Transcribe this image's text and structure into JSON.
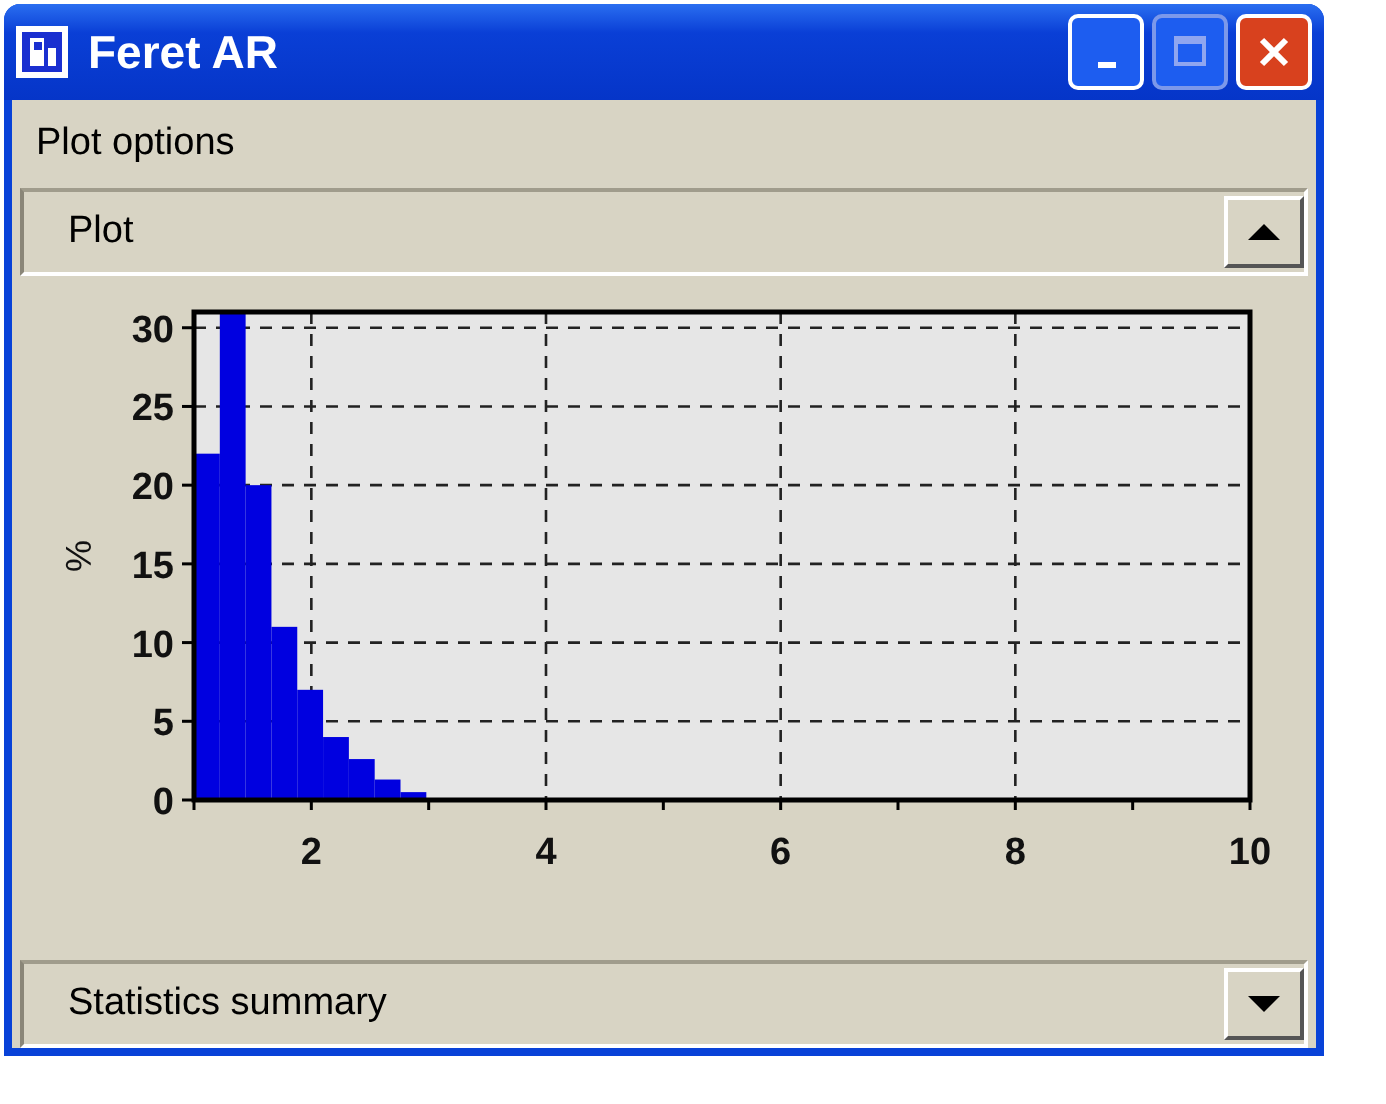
{
  "window": {
    "title": "Feret AR"
  },
  "menu": {
    "label": "Plot options"
  },
  "sections": [
    {
      "title": "Plot",
      "expanded": true
    },
    {
      "title": "Statistics summary",
      "expanded": false
    }
  ],
  "chart_data": {
    "type": "bar",
    "ylabel": "%",
    "x": [
      1.11,
      1.33,
      1.55,
      1.77,
      1.99,
      2.21,
      2.43,
      2.65,
      2.87
    ],
    "values": [
      22,
      31,
      20,
      11,
      7,
      4,
      2.6,
      1.3,
      0.5
    ],
    "xlim": [
      1,
      10
    ],
    "ylim": [
      0,
      31
    ],
    "xticks": [
      2,
      4,
      6,
      8,
      10
    ],
    "yticks": [
      0,
      5,
      10,
      15,
      20,
      25,
      30
    ],
    "grid": true
  }
}
